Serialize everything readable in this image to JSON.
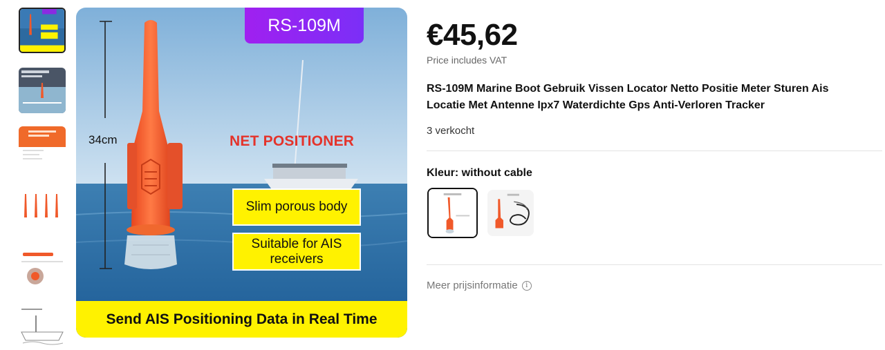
{
  "gallery": {
    "thumbnails": [
      {
        "name": "thumb-main-product",
        "label": "Send AIS Positioning Data in Real Time"
      },
      {
        "name": "thumb-sea-scene",
        "label": ""
      },
      {
        "name": "thumb-orange-banner",
        "label": ""
      },
      {
        "name": "thumb-four-devices",
        "label": ""
      },
      {
        "name": "thumb-device-details",
        "label": ""
      },
      {
        "name": "thumb-installation-diagram",
        "label": ""
      }
    ],
    "main": {
      "model_badge": "RS-109M",
      "size_label": "34cm",
      "feature_title": "NET POSITIONER",
      "features": [
        "Slim porous body",
        "Suitable for AIS receivers"
      ],
      "banner": "Send AIS Positioning Data in Real Time"
    }
  },
  "product": {
    "price": "€45,62",
    "price_note": "Price includes VAT",
    "title": "RS-109M Marine Boot Gebruik Vissen Locator Netto Positie Meter Sturen Ais Locatie Met Antenne Ipx7 Waterdichte Gps Anti-Verloren Tracker",
    "sold": "3 verkocht",
    "color_label": "Kleur: without cable",
    "variants": [
      {
        "name": "without cable",
        "selected": true
      },
      {
        "name": "with cable",
        "selected": false
      }
    ],
    "more_price_info": "Meer prijsinformatie",
    "info_icon": "ⓘ"
  },
  "colors": {
    "device_orange": "#f0592a",
    "highlight_yellow": "#fff200",
    "badge_purple": "#8a2be2",
    "feature_red": "#e4332b"
  }
}
